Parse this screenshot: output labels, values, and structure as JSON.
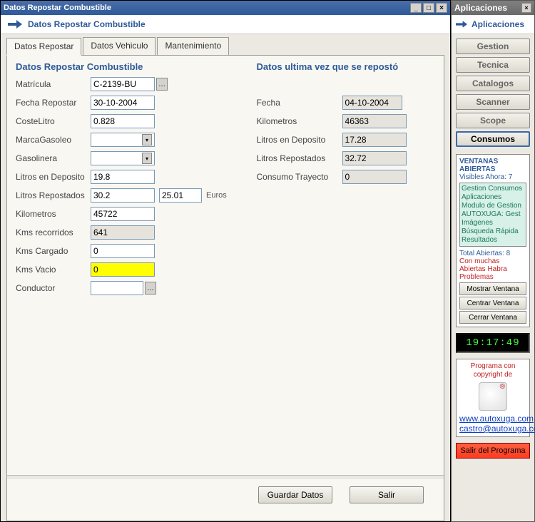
{
  "window": {
    "title": "Datos Repostar Combustible"
  },
  "subtitle": "Datos Repostar Combustible",
  "tabs": [
    "Datos Repostar",
    "Datos Vehiculo",
    "Mantenimiento"
  ],
  "form": {
    "section_title": "Datos Repostar Combustible",
    "matricula": {
      "label": "Matrícula",
      "value": "C-2139-BU"
    },
    "fecha": {
      "label": "Fecha Repostar",
      "value": "30-10-2004"
    },
    "coste": {
      "label": "CosteLitro",
      "value": "0.828"
    },
    "marca": {
      "label": "MarcaGasoleo",
      "value": ""
    },
    "gasolinera": {
      "label": "Gasolinera",
      "value": ""
    },
    "litros_dep": {
      "label": "Litros en Deposito",
      "value": "19.8"
    },
    "litros_rep": {
      "label": "Litros Repostados",
      "value": "30.2"
    },
    "litros_rep_euro": {
      "value": "25.01",
      "label": "Euros"
    },
    "km": {
      "label": "Kilometros",
      "value": "45722"
    },
    "km_rec": {
      "label": "Kms recorridos",
      "value": "641"
    },
    "km_carg": {
      "label": "Kms Cargado",
      "value": "0"
    },
    "km_vacio": {
      "label": "Kms Vacio",
      "value": "0"
    },
    "conductor": {
      "label": "Conductor",
      "value": ""
    }
  },
  "last": {
    "title": "Datos ultima vez que se repostó",
    "fecha": {
      "label": "Fecha",
      "value": "04-10-2004"
    },
    "km": {
      "label": "Kilometros",
      "value": "46363"
    },
    "litros_dep": {
      "label": "Litros en Deposito",
      "value": "17.28"
    },
    "litros_rep": {
      "label": "Litros Repostados",
      "value": "32.72"
    },
    "consumo": {
      "label": "Consumo Trayecto",
      "value": "0"
    }
  },
  "footer": {
    "guardar": "Guardar Datos",
    "salir": "Salir"
  },
  "side": {
    "title": "Aplicaciones",
    "subtitle": "Aplicaciones",
    "buttons": [
      "Gestion",
      "Tecnica",
      "Catalogos",
      "Scanner",
      "Scope",
      "Consumos"
    ],
    "open_windows": {
      "header": "VENTANAS ABIERTAS",
      "visible": "Visibles Ahora: 7",
      "list": [
        "Gestion Consumos",
        "Aplicaciones",
        "Modulo de Gestion",
        "AUTOXUGA: Gest",
        "Imágenes",
        "Búsqueda Rápida",
        "Resultados"
      ],
      "total": "Total Abiertas: 8",
      "warn": "Con muchas Abiertas Habra Problemas",
      "btn_show": "Mostrar Ventana",
      "btn_center": "Centrar Ventana",
      "btn_close": "Cerrar Ventana"
    },
    "clock": "19:17:49",
    "copyright": {
      "text": "Programa con copyright de",
      "url": "www.autoxuga.com",
      "mail": "castro@autoxuga.com"
    },
    "exit": "Salir del Programa"
  }
}
